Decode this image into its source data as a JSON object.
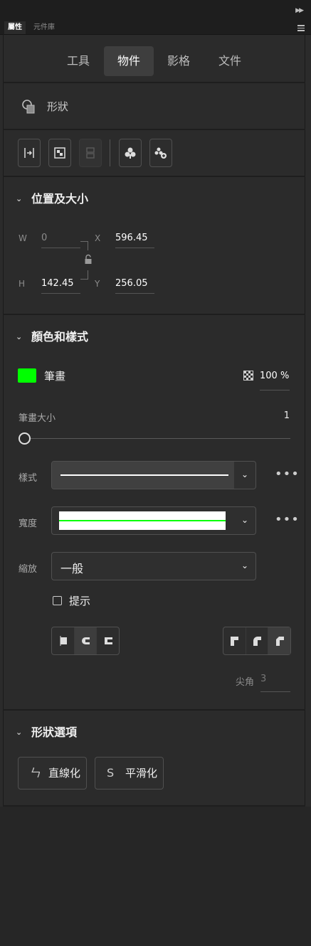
{
  "panel_tabs": {
    "properties": "屬性",
    "library": "元件庫"
  },
  "main_tabs": [
    "工具",
    "物件",
    "影格",
    "文件"
  ],
  "active_tab": "物件",
  "object": {
    "type_label": "形狀"
  },
  "toolbar": {
    "icons": [
      "align-icon",
      "swap-symbol-icon",
      "break-apart-icon",
      "create-symbol-icon",
      "edit-symbol-icon"
    ]
  },
  "position_size": {
    "title": "位置及大小",
    "w_label": "W",
    "w_value": "0",
    "h_label": "H",
    "h_value": "142.45",
    "x_label": "X",
    "x_value": "596.45",
    "y_label": "Y",
    "y_value": "256.05"
  },
  "color_style": {
    "title": "顏色和樣式",
    "stroke_label": "筆畫",
    "stroke_color": "#00ff00",
    "opacity": "100 %",
    "stroke_size_label": "筆畫大小",
    "stroke_size_value": "1",
    "stroke_size_level": 0,
    "style_label": "樣式",
    "width_label": "寬度",
    "scale_label": "縮放",
    "scale_value": "一般",
    "hint_label": "提示",
    "hint_checked": false,
    "miter_label": "尖角",
    "miter_value": "3"
  },
  "shape_options": {
    "title": "形狀選項",
    "straighten": "直線化",
    "smooth": "平滑化"
  }
}
